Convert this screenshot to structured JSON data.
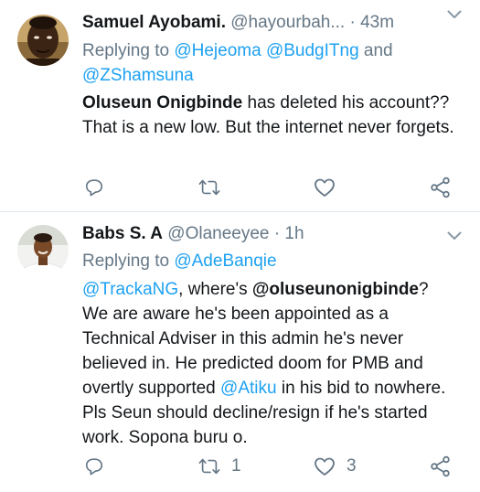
{
  "tweets": [
    {
      "name": "Samuel Ayobami.",
      "handle": "@hayourbah...",
      "dot": "·",
      "time": "43m",
      "replying_prefix": "Replying to ",
      "replying_line1_mentions": [
        "@Hejeoma",
        "@BudgITng"
      ],
      "replying_and": " and",
      "replying_line2_mention": "@ZShamsuna",
      "body_bold": "Oluseun Onigbinde",
      "body_rest": " has deleted his account?? That is a new low. But the internet never forgets.",
      "reply_count": "",
      "retweet_count": "",
      "like_count": ""
    },
    {
      "name": "Babs S. A",
      "handle": "@Olaneeyee",
      "dot": "·",
      "time": "1h",
      "replying_prefix": "Replying to ",
      "replying_mention": "@AdeBanqie",
      "body_mention1": "@TrackaNG",
      "body_part1": ", where's ",
      "body_mention2_bold": "@oluseunonigbinde",
      "body_part2": "? We are aware he's been appointed as a Technical Adviser in this admin he's never believed in. He predicted doom for PMB and overtly supported ",
      "body_mention3": "@Atiku",
      "body_part3": " in his bid to nowhere. Pls Seun should decline/resign if he's started work. Sopona buru o.",
      "reply_count": "",
      "retweet_count": "1",
      "like_count": "3"
    }
  ],
  "colors": {
    "name": "#14171a",
    "secondary": "#657786",
    "link": "#1da1f2",
    "divider": "#e1e8ed"
  },
  "icons": {
    "reply": "reply-icon",
    "retweet": "retweet-icon",
    "like": "heart-icon",
    "share": "share-icon",
    "menu": "chevron-down-icon"
  }
}
